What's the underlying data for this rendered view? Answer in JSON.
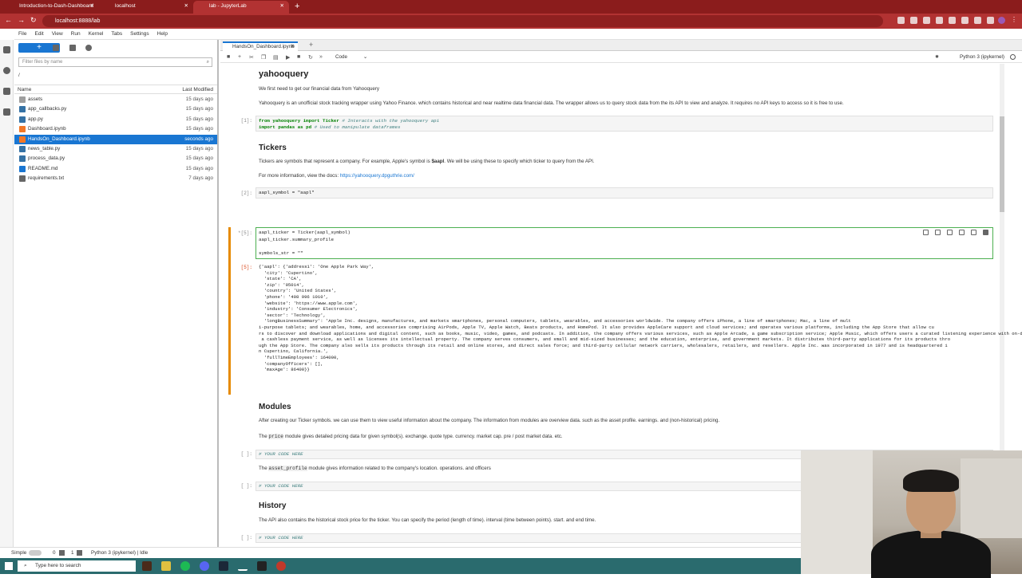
{
  "browser": {
    "tabs": [
      {
        "title": "Introduction-to-Dash-Dashboard",
        "active": false
      },
      {
        "title": "localhost",
        "active": false
      },
      {
        "title": "lab - JupyterLab",
        "active": true
      }
    ],
    "url": "localhost:8888/lab"
  },
  "menu": [
    "File",
    "Edit",
    "View",
    "Run",
    "Kernel",
    "Tabs",
    "Settings",
    "Help"
  ],
  "filebrowser": {
    "new_label": "+",
    "filter_placeholder": "Filter files by name",
    "path": "/",
    "col_name": "Name",
    "col_modified": "Last Modified",
    "files": [
      {
        "name": "assets",
        "modified": "15 days ago",
        "type": "folder"
      },
      {
        "name": "app_callbacks.py",
        "modified": "15 days ago",
        "type": "py"
      },
      {
        "name": "app.py",
        "modified": "15 days ago",
        "type": "py"
      },
      {
        "name": "Dashboard.ipynb",
        "modified": "15 days ago",
        "type": "nb"
      },
      {
        "name": "HandsOn_Dashboard.ipynb",
        "modified": "seconds ago",
        "type": "nb",
        "selected": true
      },
      {
        "name": "news_table.py",
        "modified": "15 days ago",
        "type": "py"
      },
      {
        "name": "process_data.py",
        "modified": "15 days ago",
        "type": "py"
      },
      {
        "name": "README.md",
        "modified": "15 days ago",
        "type": "md"
      },
      {
        "name": "requirements.txt",
        "modified": "7 days ago",
        "type": "txt"
      }
    ]
  },
  "notebook": {
    "tab_title": "HandsOn_Dashboard.ipynb",
    "cell_type": "Code",
    "kernel": "Python 3 (ipykernel)",
    "h_yahooquery": "yahooquery",
    "p1": "We first need to get our financial data from Yahooquery",
    "p2": "Yahooquery is an unofficial stock tracking wrapper using Yahoo Finance. which contains historical and near realtime data financial data. The wrapper allows us to query stock data from the its API to view and analyze. It requires no API keys to access so it is free to use.",
    "prompt1": "[1]:",
    "code1_l1a": "from yahooquery import Ticker ",
    "code1_l1b": "# Interacts with the yahooquery api",
    "code1_l2a": "import pandas as pd ",
    "code1_l2b": "# Used to manipulate dataframes",
    "h_tickers": "Tickers",
    "p3a": "Tickers are symbols that represent a company. For example, Apple's symbol is ",
    "p3b": "$aapl",
    "p3c": ". We will be using these to specify which ticker to query from the API.",
    "p4a": "For more information, view the docs: ",
    "p4b": "https://yahooquery.dpguthrie.com/",
    "prompt2": "[2]:",
    "code2": "aapl_symbol = \"aapl\"",
    "prompt5": "*[5]:",
    "code5": "aapl_ticker = Ticker(aapl_symbol)\naapl_ticker.summary_profile\n\nsymbols_str = \"\"",
    "out_prompt": "[5]:",
    "output": "{'aapl': {'address1': 'One Apple Park Way',\n  'city': 'Cupertino',\n  'state': 'CA',\n  'zip': '95014',\n  'country': 'United States',\n  'phone': '408 996 1010',\n  'website': 'https://www.apple.com',\n  'industry': 'Consumer Electronics',\n  'sector': 'Technology',\n  'longBusinessSummary': 'Apple Inc. designs, manufactures, and markets smartphones, personal computers, tablets, wearables, and accessories worldwide. The company offers iPhone, a line of smartphones; Mac, a line of mult\ni-purpose tablets; and wearables, home, and accessories comprising AirPods, Apple TV, Apple Watch, Beats products, and HomePod. It also provides AppleCare support and cloud services; and operates various platforms, including the App Store that allow cu\nrs to discover and download applications and digital content, such as books, music, video, games, and podcasts. In addition, the company offers various services, such as Apple Arcade, a game subscription service; Apple Music, which offers users a curated listening experience with on-demand radio stations; Apple News+, a subscription news and magazine service; Apple TV+, which offers exclusive original content; Apple Card, a co-branded credit card; and Apple Pay,\n a cashless payment service, as well as licenses its intellectual property. The company serves consumers, and small and mid-sized businesses; and the education, enterprise, and government markets. It distributes third-party applications for its products thro\nugh the App Store. The company also sells its products through its retail and online stores, and direct sales force; and third-party cellular network carriers, wholesalers, retailers, and resellers. Apple Inc. was incorporated in 1977 and is headquartered i\nn Cupertino, California.',\n  'fullTimeEmployees': 164000,\n  'companyOfficers': [],\n  'maxAge': 86400}}",
    "h_modules": "Modules",
    "p5": "After creating our Ticker symbols. we can use them to view useful information about the company. The information from modules are overview data. such as the asset profile. earnings. and (non-historical) pricing.",
    "p6a": "The ",
    "p6b": "price",
    "p6c": " module gives detailed pricing data for given symbol(s). exchange. quote type. currency. market cap. pre / post market data. etc.",
    "prompt_empty": "[ ]:",
    "your_code": "# YOUR CODE HERE",
    "p7a": "The ",
    "p7b": "asset_profile",
    "p7c": " module gives information related to the company's location. operations. and officers",
    "h_history": "History",
    "p8": "The API also contains the historical stock price for the ticker. You can specify the period (length of time). interval (time between points). start. and end time."
  },
  "statusbar": {
    "mode": "Simple",
    "num1": "0",
    "num2": "1",
    "kernel_status": "Python 3 (ipykernel) | Idle"
  },
  "taskbar": {
    "search_placeholder": "Type here to search"
  }
}
